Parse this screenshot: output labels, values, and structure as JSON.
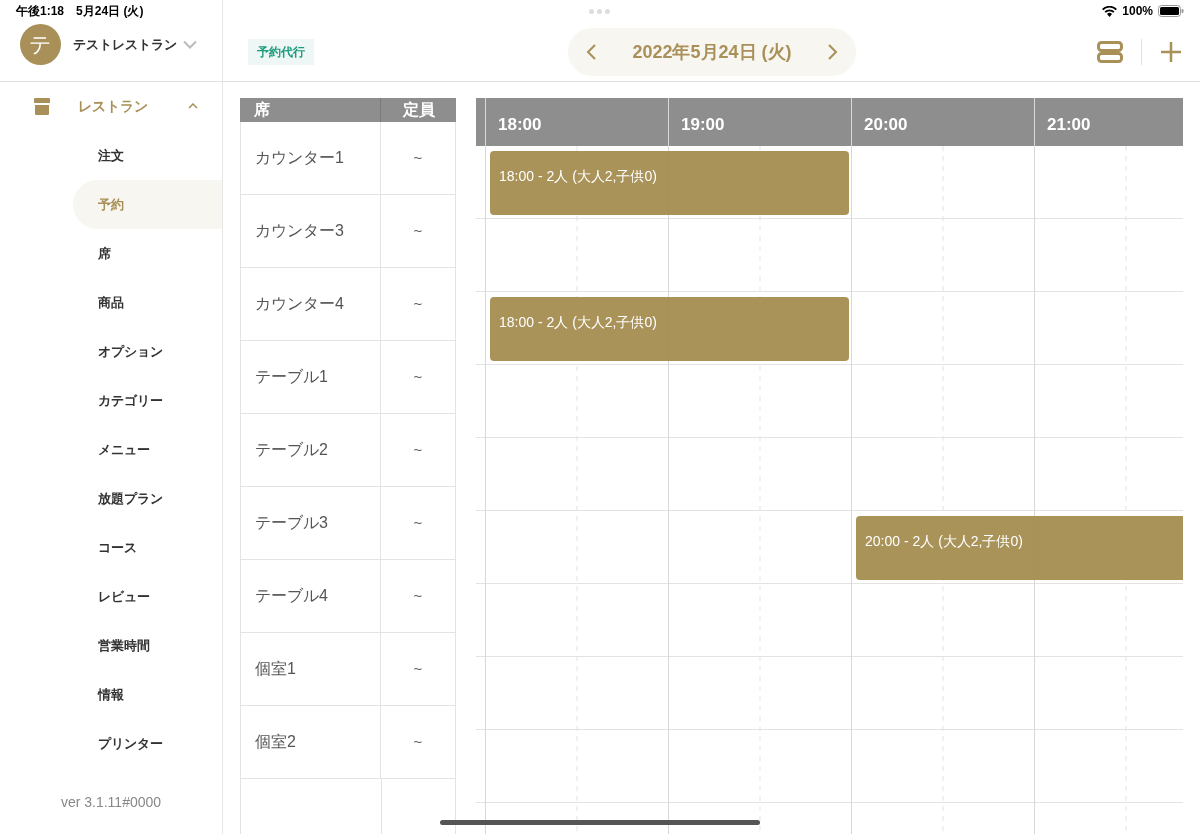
{
  "status_bar": {
    "time": "午後1:18",
    "date": "5月24日 (火)",
    "battery": "100%"
  },
  "account": {
    "avatar": "テ",
    "name": "テストレストラン"
  },
  "sidebar": {
    "section": {
      "label": "レストラン",
      "expanded": true
    },
    "items": [
      {
        "label": "注文",
        "selected": false
      },
      {
        "label": "予約",
        "selected": true
      },
      {
        "label": "席",
        "selected": false
      },
      {
        "label": "商品",
        "selected": false
      },
      {
        "label": "オプション",
        "selected": false
      },
      {
        "label": "カテゴリー",
        "selected": false
      },
      {
        "label": "メニュー",
        "selected": false
      },
      {
        "label": "放題プラン",
        "selected": false
      },
      {
        "label": "コース",
        "selected": false
      },
      {
        "label": "レビュー",
        "selected": false
      },
      {
        "label": "営業時間",
        "selected": false
      },
      {
        "label": "情報",
        "selected": false
      },
      {
        "label": "プリンター",
        "selected": false
      }
    ],
    "version": "ver 3.1.11#0000"
  },
  "toolbar": {
    "badge": "予約代行",
    "date": "2022年5月24日 (火)"
  },
  "table": {
    "columns": [
      "席",
      "定員"
    ],
    "rows": [
      {
        "seat": "カウンター1",
        "capacity": "~",
        "reservation": "18:00 - 2人 (大人2,子供0)"
      },
      {
        "seat": "カウンター3",
        "capacity": "~"
      },
      {
        "seat": "カウンター4",
        "capacity": "~",
        "reservation": "18:00 - 2人 (大人2,子供0)"
      },
      {
        "seat": "テーブル1",
        "capacity": "~"
      },
      {
        "seat": "テーブル2",
        "capacity": "~"
      },
      {
        "seat": "テーブル3",
        "capacity": "~",
        "reservation": "20:00 - 2人 (大人2,子供0)"
      },
      {
        "seat": "テーブル4",
        "capacity": "~"
      },
      {
        "seat": "個室1",
        "capacity": "~"
      },
      {
        "seat": "個室2",
        "capacity": "~"
      }
    ]
  },
  "timeline": {
    "hours": [
      "18:00",
      "19:00",
      "20:00",
      "21:00"
    ]
  }
}
